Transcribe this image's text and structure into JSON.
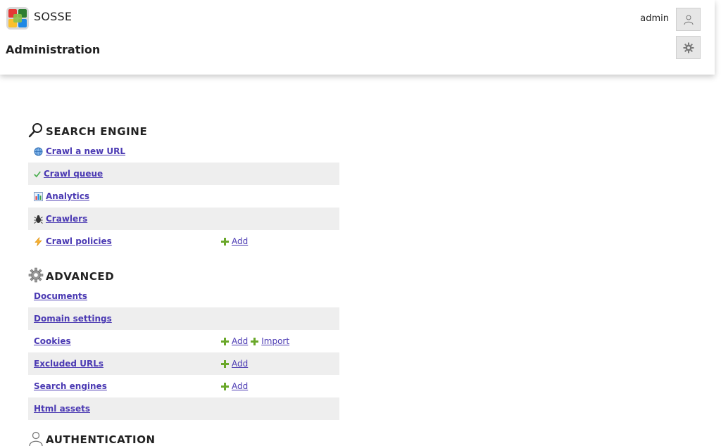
{
  "header": {
    "app_name": "SOSSE",
    "page_title": "Administration",
    "username": "admin"
  },
  "sections": {
    "search_engine": {
      "title": "SEARCH ENGINE",
      "icon": "magnifier-icon",
      "rows": [
        {
          "label": "Crawl a new URL",
          "icon": "globe-icon"
        },
        {
          "label": "Crawl queue",
          "icon": "check-icon"
        },
        {
          "label": "Analytics",
          "icon": "chart-icon"
        },
        {
          "label": "Crawlers",
          "icon": "bug-icon"
        },
        {
          "label": "Crawl policies",
          "icon": "lightning-icon",
          "actions": [
            "Add"
          ]
        }
      ]
    },
    "advanced": {
      "title": "ADVANCED",
      "icon": "gear-icon",
      "rows": [
        {
          "label": "Documents"
        },
        {
          "label": "Domain settings"
        },
        {
          "label": "Cookies",
          "actions": [
            "Add",
            "Import"
          ]
        },
        {
          "label": "Excluded URLs",
          "actions": [
            "Add"
          ]
        },
        {
          "label": "Search engines",
          "actions": [
            "Add"
          ]
        },
        {
          "label": "Html assets"
        }
      ]
    },
    "authentication": {
      "title": "AUTHENTICATION",
      "icon": "user-icon"
    }
  },
  "colors": {
    "link": "#4b3ab3",
    "plus": "#6aa82a",
    "row_alt": "#eeeeee"
  }
}
